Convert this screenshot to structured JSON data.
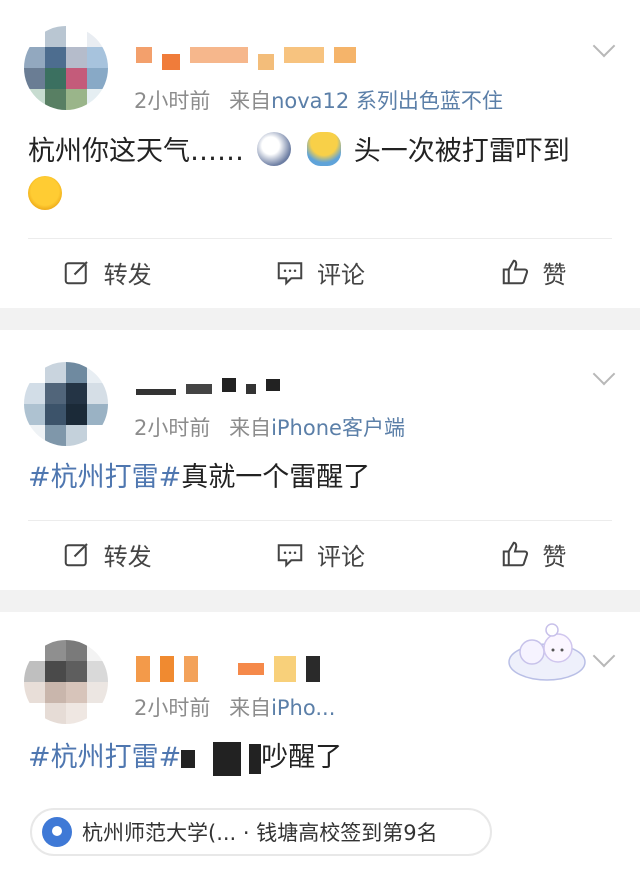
{
  "posts": [
    {
      "time": "2小时前",
      "source_prefix": "来自",
      "device": "nova12 系列出色蓝不住",
      "content": "杭州你这天气……",
      "content_tail": "头一次被打雷吓到",
      "actions": {
        "repost": "转发",
        "comment": "评论",
        "like": "赞"
      }
    },
    {
      "time": "2小时前",
      "source_prefix": "来自",
      "device": "iPhone客户端",
      "tag": "#杭州打雷#",
      "content": "真就一个雷醒了",
      "actions": {
        "repost": "转发",
        "comment": "评论",
        "like": "赞"
      }
    },
    {
      "time": "2小时前",
      "source_prefix": "来自",
      "device": "iPho...",
      "tag": "#杭州打雷#",
      "content": "吵醒了",
      "location": "杭州师范大学(... · 钱塘高校签到第9名"
    }
  ],
  "colors": {
    "accent": "#4f77b0",
    "pin": "#3f79d6"
  },
  "icons": {
    "repost": "edit-square-icon",
    "comment": "comment-bubble-icon",
    "like": "thumbs-up-icon",
    "more": "chevron-down-icon",
    "location": "location-pin-icon"
  }
}
